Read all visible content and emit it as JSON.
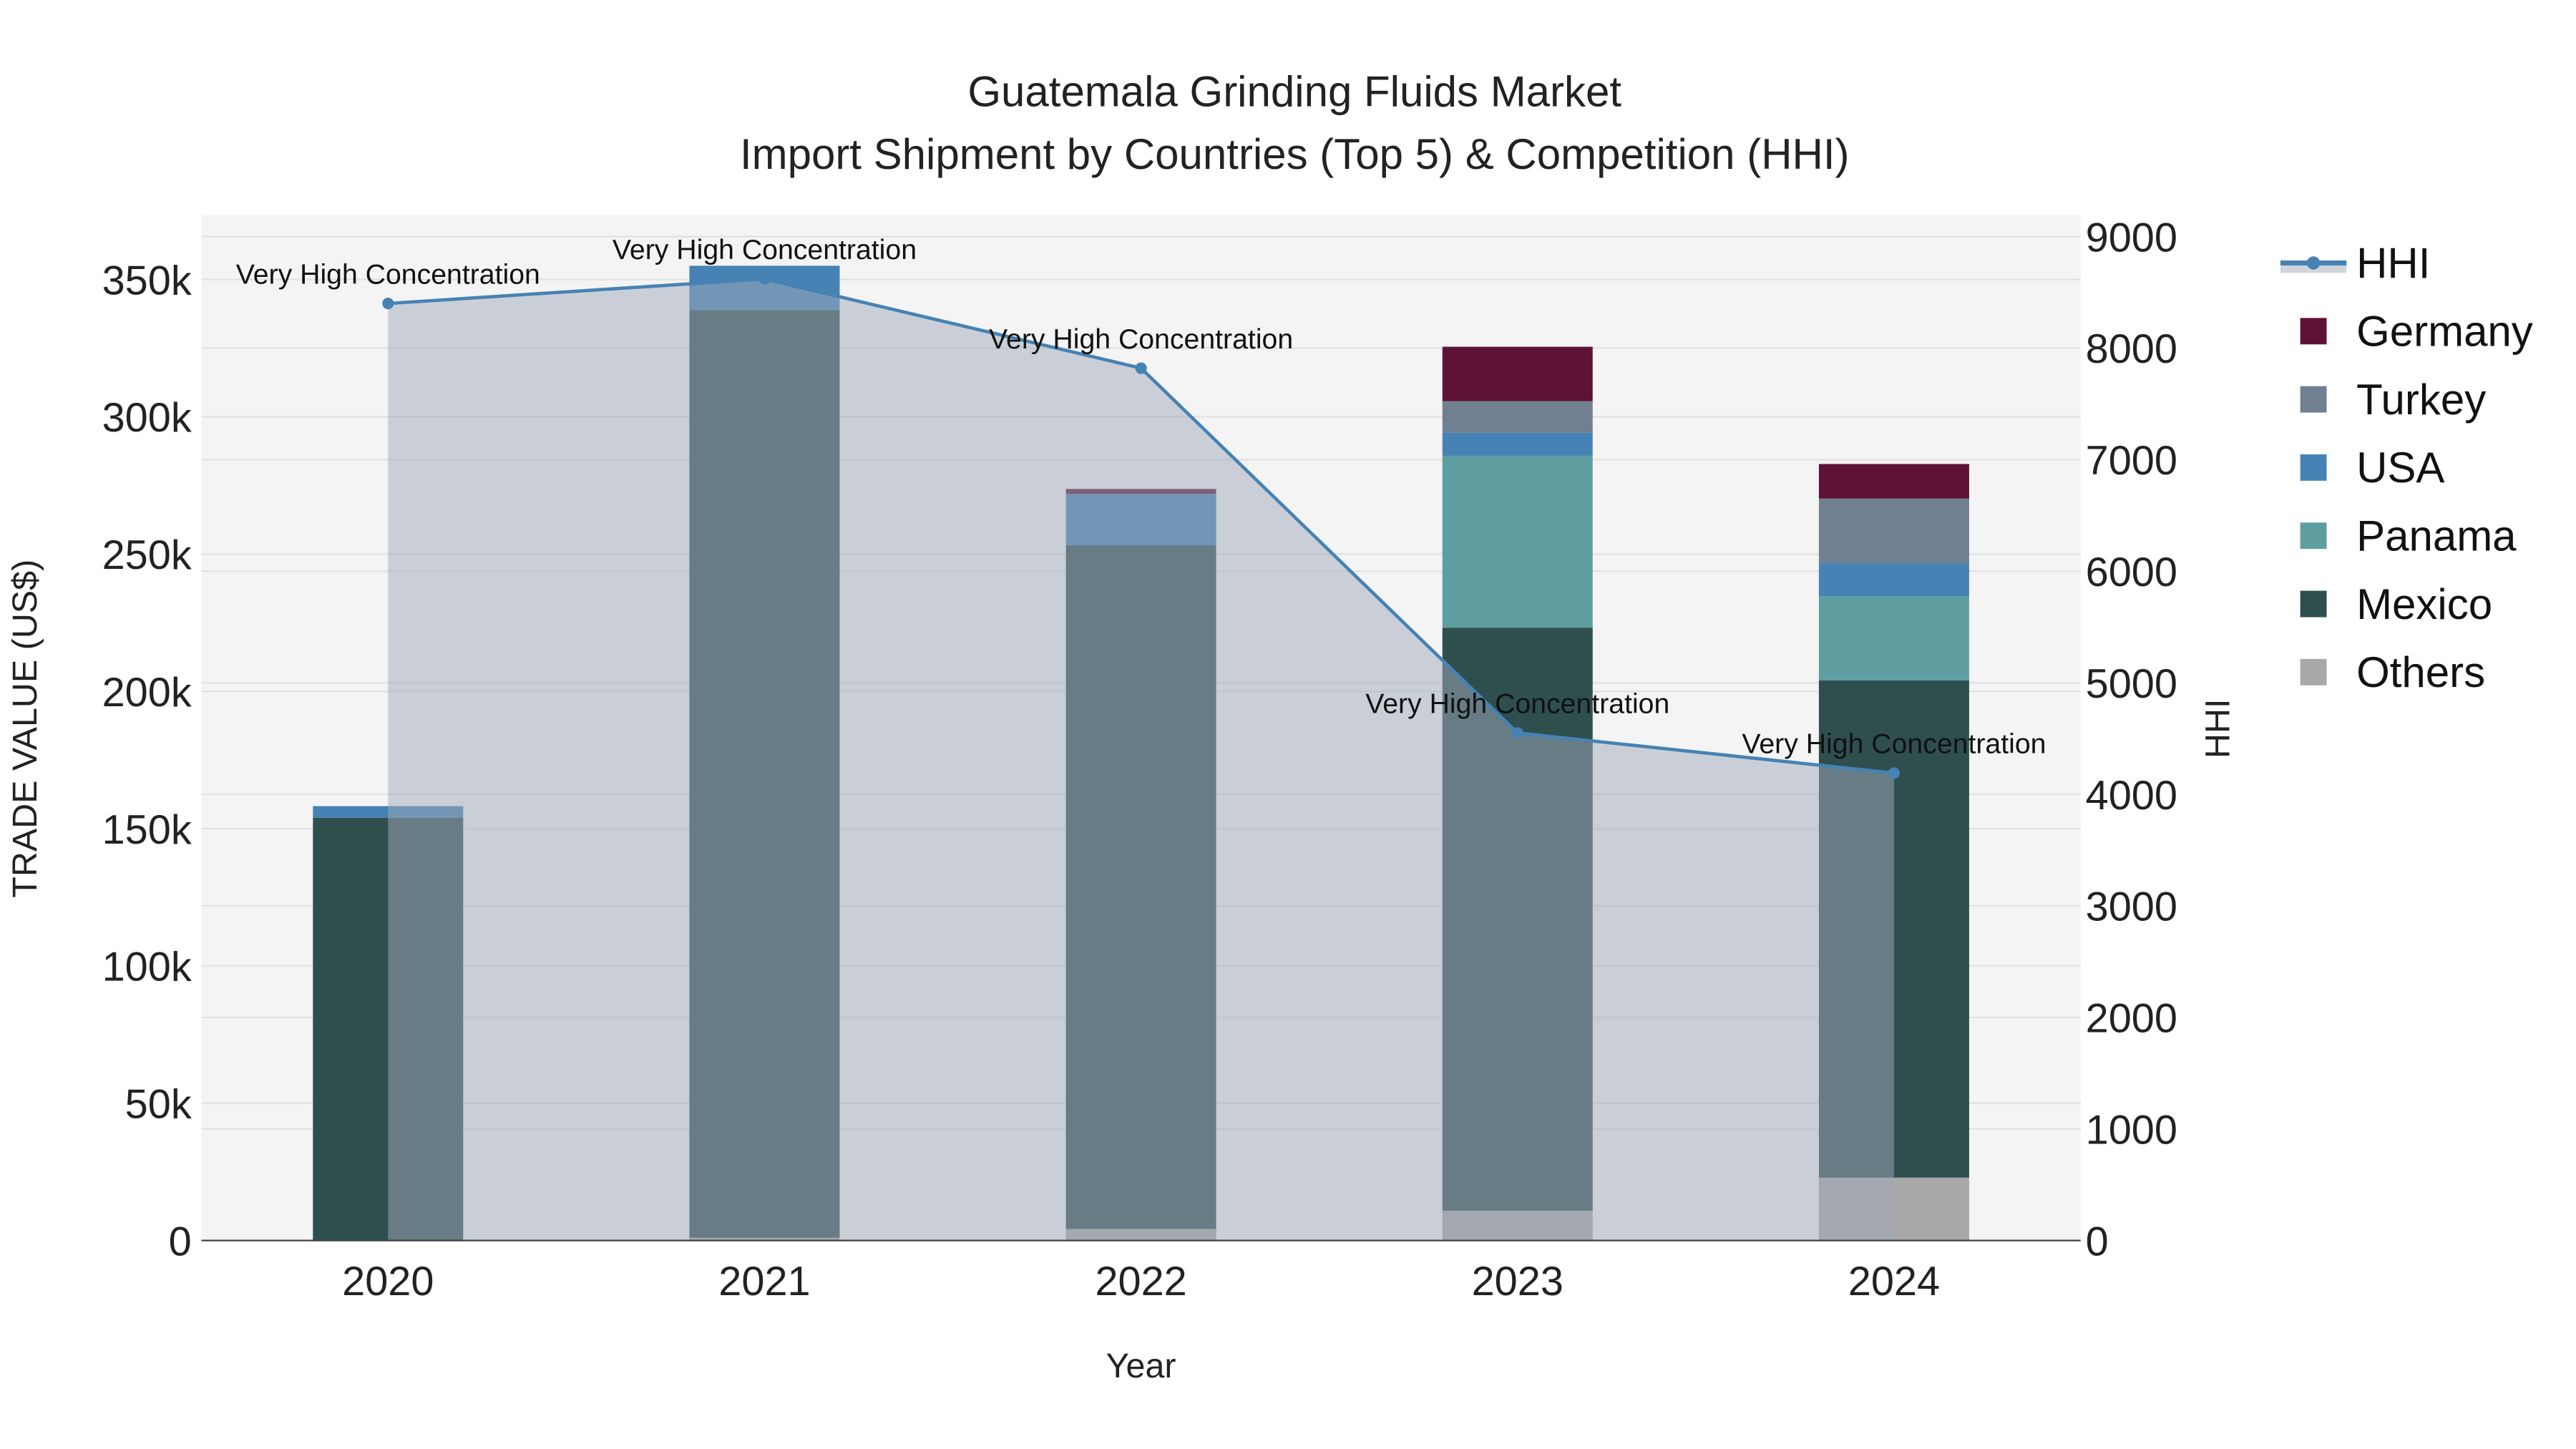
{
  "chart_data": {
    "type": "bar",
    "title": "Guatemala Grinding Fluids Market",
    "subtitle": "Import Shipment by Countries (Top 5) & Competition (HHI)",
    "xlabel": "Year",
    "ylabel": "TRADE VALUE (US$)",
    "y2label": "HHI",
    "categories": [
      "2020",
      "2021",
      "2022",
      "2023",
      "2024"
    ],
    "ylim": [
      0,
      370000
    ],
    "y2lim": [
      0,
      9200
    ],
    "yticks": [
      0,
      50000,
      100000,
      150000,
      200000,
      250000,
      300000,
      350000
    ],
    "yticklabels": [
      "0",
      "50k",
      "100k",
      "150k",
      "200k",
      "250k",
      "300k",
      "350k"
    ],
    "y2ticks": [
      0,
      1000,
      2000,
      3000,
      4000,
      5000,
      6000,
      7000,
      8000,
      9000
    ],
    "y2ticklabels": [
      "0",
      "1000",
      "2000",
      "3000",
      "4000",
      "5000",
      "6000",
      "7000",
      "8000",
      "9000"
    ],
    "grid": true,
    "legend_position": "right",
    "stacked": true,
    "series": [
      {
        "name": "Others",
        "color": "#a9a9a9",
        "values": [
          0,
          1000,
          4200,
          10800,
          22900
        ]
      },
      {
        "name": "Mexico",
        "color": "#2f4f4f",
        "values": [
          154000,
          337800,
          249000,
          212400,
          181100
        ]
      },
      {
        "name": "Panama",
        "color": "#5f9ea0",
        "values": [
          0,
          0,
          0,
          62600,
          30700
        ]
      },
      {
        "name": "USA",
        "color": "#4682b4",
        "values": [
          4200,
          16200,
          18700,
          8400,
          12000
        ]
      },
      {
        "name": "Turkey",
        "color": "#708090",
        "values": [
          0,
          0,
          0,
          11500,
          23500
        ]
      },
      {
        "name": "Germany",
        "color": "#5e1235",
        "values": [
          0,
          0,
          1800,
          19800,
          12600
        ]
      }
    ],
    "line": {
      "name": "HHI",
      "color": "#4682b4",
      "fill": "rgba(160,170,185,0.5)",
      "values": [
        8400,
        8620,
        7820,
        4550,
        4190
      ],
      "annotations": [
        "Very High Concentration",
        "Very High Concentration",
        "Very High Concentration",
        "Very High Concentration",
        "Very High Concentration"
      ]
    },
    "legend_order": [
      "HHI",
      "Germany",
      "Turkey",
      "USA",
      "Panama",
      "Mexico",
      "Others"
    ]
  }
}
